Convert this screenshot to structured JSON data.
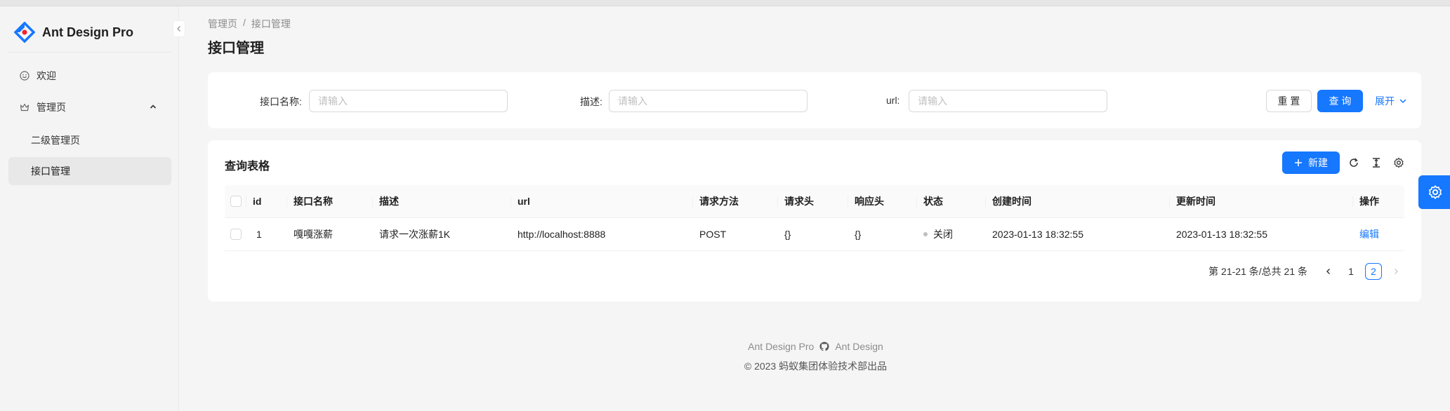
{
  "app": {
    "title": "Ant Design Pro"
  },
  "sidebar": {
    "items": [
      {
        "label": "欢迎",
        "icon": "smile-icon"
      },
      {
        "label": "管理页",
        "icon": "crown-icon",
        "expanded": true
      },
      {
        "label": "二级管理页"
      },
      {
        "label": "接口管理",
        "active": true
      }
    ]
  },
  "breadcrumb": [
    "管理页",
    "/",
    "接口管理"
  ],
  "page": {
    "title": "接口管理"
  },
  "search": {
    "fields": [
      {
        "label": "接口名称:",
        "placeholder": "请输入"
      },
      {
        "label": "描述:",
        "placeholder": "请输入"
      },
      {
        "label": "url:",
        "placeholder": "请输入"
      }
    ],
    "reset_label": "重 置",
    "query_label": "查 询",
    "expand_label": "展开"
  },
  "table": {
    "title": "查询表格",
    "new_label": "新建",
    "columns": [
      "id",
      "接口名称",
      "描述",
      "url",
      "请求方法",
      "请求头",
      "响应头",
      "状态",
      "创建时间",
      "更新时间",
      "操作"
    ],
    "rows": [
      {
        "id": "1",
        "name": "嘎嘎涨薪",
        "desc": "请求一次涨薪1K",
        "url": "http://localhost:8888",
        "method": "POST",
        "req_header": "{}",
        "resp_header": "{}",
        "status": "关闭",
        "created": "2023-01-13 18:32:55",
        "updated": "2023-01-13 18:32:55",
        "action": "编辑"
      }
    ]
  },
  "pagination": {
    "summary": "第 21-21 条/总共 21 条",
    "pages": [
      "1",
      "2"
    ],
    "current": "2"
  },
  "footer": {
    "links": [
      "Ant Design Pro",
      "Ant Design"
    ],
    "copyright": "2023 蚂蚁集团体验技术部出品"
  },
  "colors": {
    "primary": "#1677ff",
    "status_off": "#bfbfbf"
  }
}
